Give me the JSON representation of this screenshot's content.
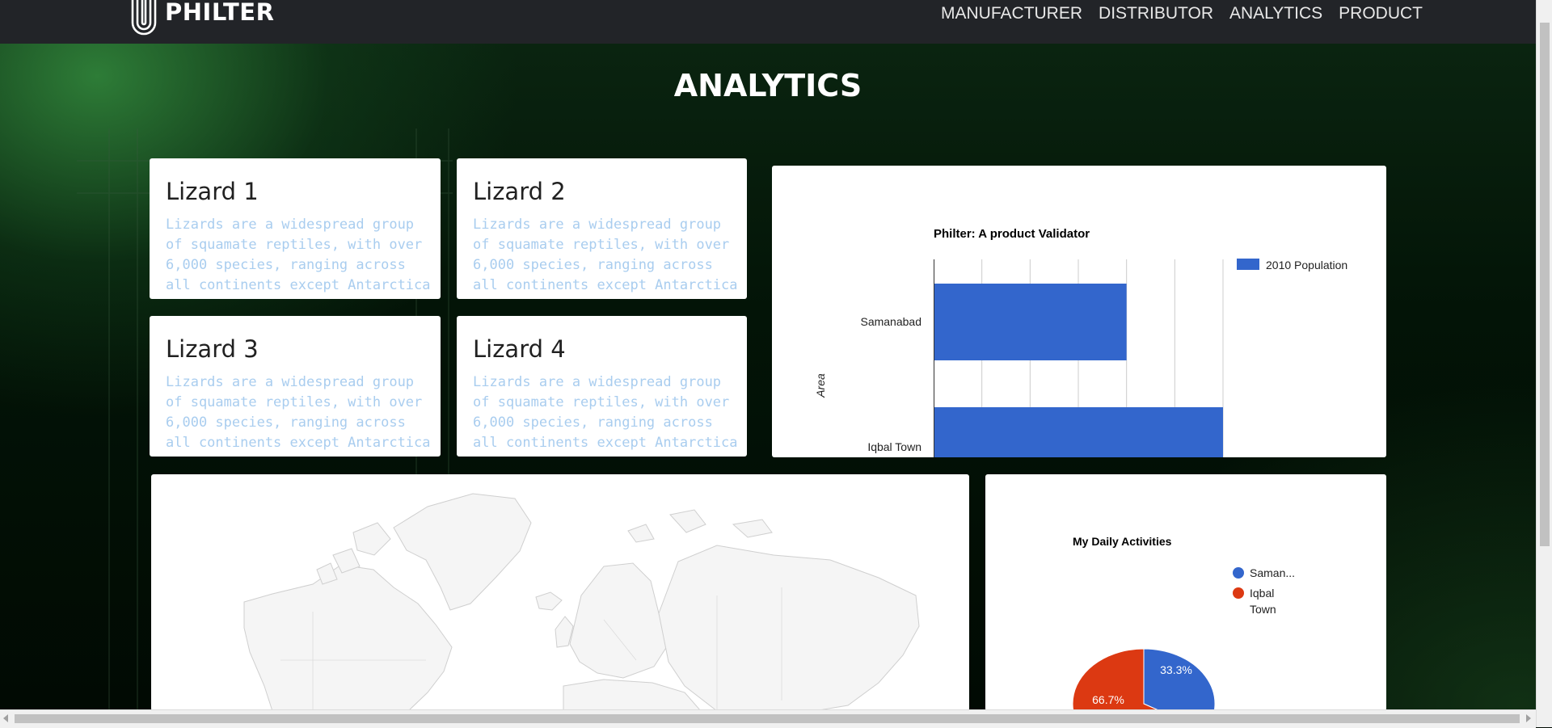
{
  "brand": {
    "name": "PHILTER"
  },
  "nav": [
    "MANUFACTURER",
    "DISTRIBUTOR",
    "ANALYTICS",
    "PRODUCT"
  ],
  "page_title": "ANALYTICS",
  "cards": [
    {
      "title": "Lizard 1",
      "text": "Lizards are a widespread group of squamate reptiles, with over 6,000 species, ranging across all continents except Antarctica"
    },
    {
      "title": "Lizard 2",
      "text": "Lizards are a widespread group of squamate reptiles, with over 6,000 species, ranging across all continents except Antarctica"
    },
    {
      "title": "Lizard 3",
      "text": "Lizards are a widespread group of squamate reptiles, with over 6,000 species, ranging across all continents except Antarctica"
    },
    {
      "title": "Lizard 4",
      "text": "Lizards are a widespread group of squamate reptiles, with over 6,000 species, ranging across all continents except Antarctica"
    }
  ],
  "chart_data": [
    {
      "type": "bar",
      "orientation": "horizontal",
      "title": "Philter: A product Validator",
      "xlabel": "",
      "ylabel": "Area",
      "categories": [
        "Samanabad",
        "Iqbal Town"
      ],
      "series": [
        {
          "name": "2010 Population",
          "values": [
            4,
            6
          ],
          "color": "#3366cc"
        }
      ],
      "xlim": [
        0,
        6
      ],
      "grid": true,
      "legend": "right"
    },
    {
      "type": "pie",
      "title": "My Daily Activities",
      "labels": [
        "Saman...",
        "Iqbal Town"
      ],
      "values": [
        33.3,
        66.7
      ],
      "value_labels": [
        "33.3%",
        "66.7%"
      ],
      "colors": [
        "#3366cc",
        "#dc3912"
      ],
      "legend": "right"
    }
  ],
  "map": {
    "type": "geo",
    "fill": "#f5f5f5",
    "stroke": "#cccccc"
  }
}
